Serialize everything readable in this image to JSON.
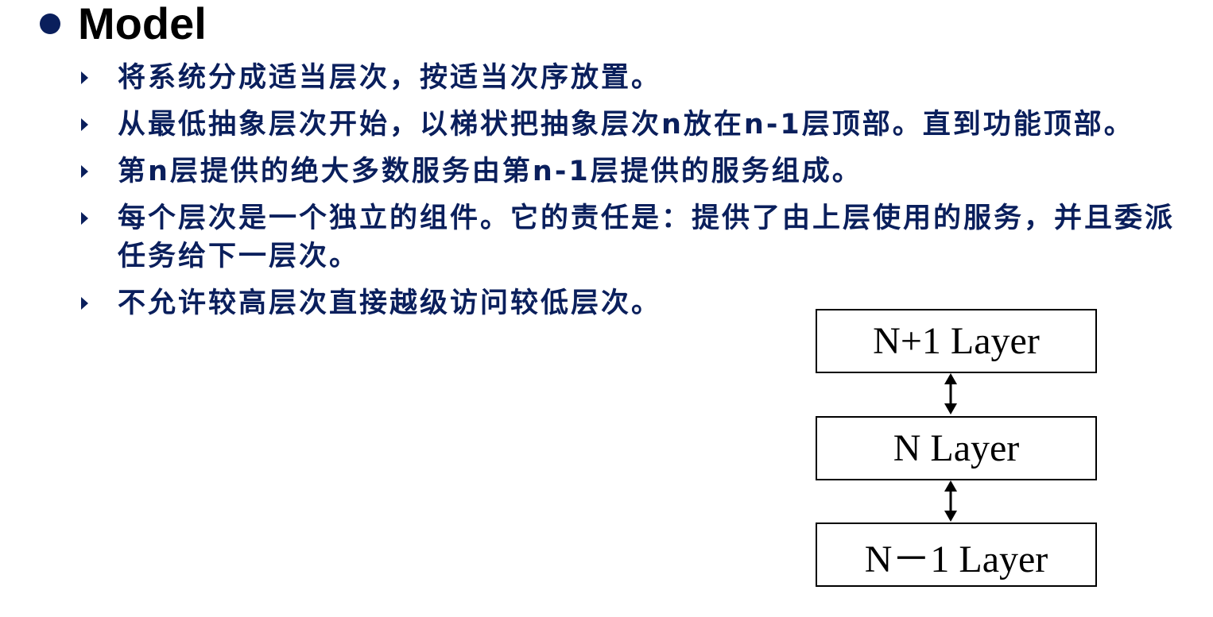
{
  "slide": {
    "title": "Model",
    "bullets": [
      "将系统分成适当层次，按适当次序放置。",
      "从最低抽象层次开始，以梯状把抽象层次n放在n-1层顶部。直到功能顶部。",
      "第n层提供的绝大多数服务由第n-1层提供的服务组成。",
      "每个层次是一个独立的组件。它的责任是：提供了由上层使用的服务，并且委派任务给下一层次。",
      "不允许较高层次直接越级访问较低层次。"
    ],
    "colors": {
      "text": "#0a1f5c",
      "title": "#000000",
      "bullet_marker": "#0a1f5c"
    },
    "icons": {
      "title_bullet": "filled-circle",
      "item_bullet": "right-triangle",
      "connector": "double-headed-vertical-arrow"
    }
  },
  "diagram": {
    "layers": [
      "N+1 Layer",
      "N Layer",
      "N－1 Layer"
    ]
  }
}
